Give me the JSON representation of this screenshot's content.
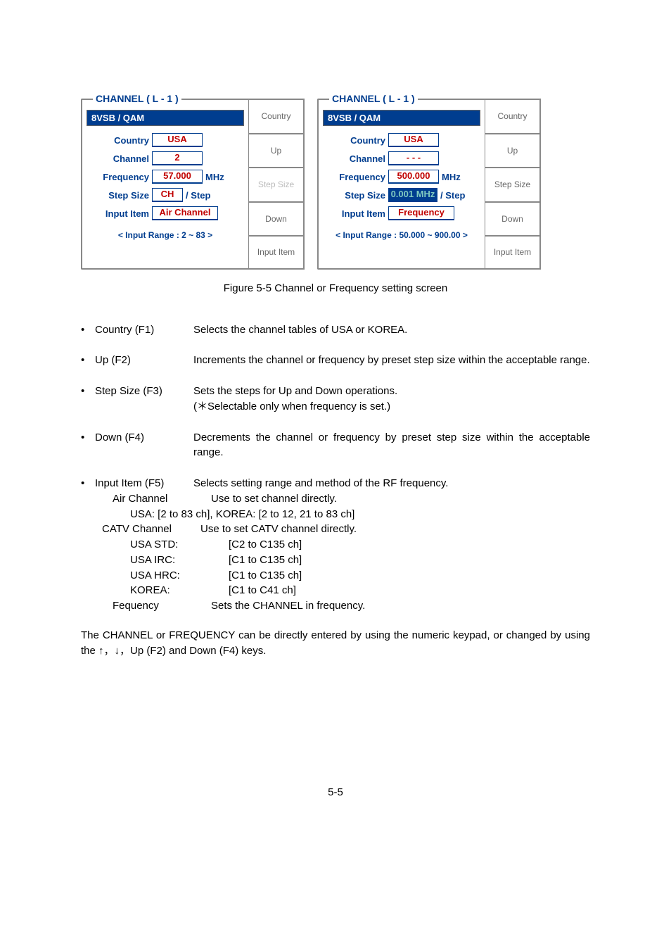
{
  "panelLeft": {
    "title": "CHANNEL ( L - 1 )",
    "mode": "8VSB / QAM",
    "country": "USA",
    "channel": "2",
    "frequency": "57.000",
    "freqUnit": "MHz",
    "stepSize": "CH",
    "stepUnit": "/ Step",
    "inputItem": "Air Channel",
    "inputRange": "< Input Range : 2 ~ 83 >"
  },
  "panelRight": {
    "title": "CHANNEL ( L - 1 )",
    "mode": "8VSB / QAM",
    "country": "USA",
    "channel": "- - -",
    "frequency": "500.000",
    "freqUnit": "MHz",
    "stepSize": "0.001 MHz",
    "stepUnit": "/ Step",
    "inputItem": "Frequency",
    "inputRange": "< Input Range : 50.000 ~ 900.00 >"
  },
  "buttonsLeft": [
    "Country",
    "Up",
    "Step Size",
    "Down",
    "Input Item"
  ],
  "buttonsRight": [
    "Country",
    "Up",
    "Step Size",
    "Down",
    "Input Item"
  ],
  "figCaption": "Figure 5-5    Channel or Frequency setting screen",
  "items": {
    "country": {
      "term": "Country (F1)",
      "def": "Selects the channel tables of USA or KOREA."
    },
    "up": {
      "term": "Up (F2)",
      "def": "Increments the channel or frequency by preset step size within the acceptable range."
    },
    "step": {
      "term": "Step Size (F3)",
      "def1": "Sets the steps for Up and Down operations.",
      "def2": "(＊Selectable only when frequency is set.)"
    },
    "down": {
      "term": "Down (F4)",
      "def": "Decrements the channel or frequency by preset step size within the acceptable range."
    },
    "input": {
      "term": "Input Item (F5)",
      "def": "Selects setting range and method of the RF frequency."
    }
  },
  "sub": {
    "air": {
      "term": "Air Channel",
      "def": "Use to set channel directly."
    },
    "airRange": "USA: [2 to 83 ch], KOREA: [2 to 12, 21 to 83 ch]",
    "catv": {
      "term": "CATV Channel",
      "def": "Use to set CATV channel directly."
    },
    "usaStd": {
      "term": "USA STD:",
      "def": "[C2 to C135 ch]"
    },
    "usaIrc": {
      "term": "USA IRC:",
      "def": "[C1 to C135 ch]"
    },
    "usaHrc": {
      "term": "USA HRC:",
      "def": "[C1 to C135 ch]"
    },
    "korea": {
      "term": "KOREA:",
      "def": "[C1 to C41 ch]"
    },
    "freq": {
      "term": "Fequency",
      "def": "Sets the CHANNEL in frequency."
    }
  },
  "para": "The CHANNEL or FREQUENCY can be directly entered by using the numeric keypad, or changed by using the ↑，↓，Up (F2) and Down (F4) keys.",
  "pageNum": "5-5"
}
